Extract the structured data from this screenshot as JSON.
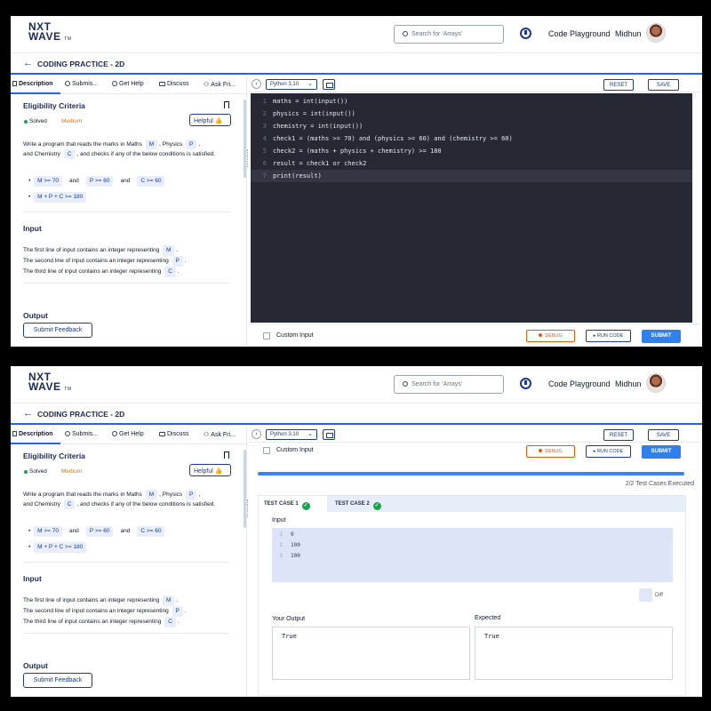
{
  "header": {
    "logo_line1": "NXT",
    "logo_line2": "WAVE",
    "logo_tm": "TM",
    "search_placeholder": "Search for 'Arrays'",
    "playground_label": "Code Playground",
    "username": "Midhun"
  },
  "practice": {
    "title": "CODING PRACTICE - 2D"
  },
  "tabs": {
    "description": "Description",
    "submissions": "Submis...",
    "get_help": "Get Help",
    "discuss": "Discuss",
    "ask_friends": "Ask Fri..."
  },
  "problem": {
    "title": "Eligibility Criteria",
    "status": "Solved",
    "difficulty": "Medium",
    "helpful_label": "Helpful",
    "statement_p1": "Write a program that reads the marks in Maths",
    "var_m": "M",
    "statement_p2": ", Physics",
    "var_p": "P",
    "statement_p3": ",",
    "statement_p4": "and Chemistry",
    "var_c": "C",
    "statement_p5": ", and checks if any of the below conditions is satisfied.",
    "cond1_a": "M >= 70",
    "cond1_and1": "and",
    "cond1_b": "P >= 60",
    "cond1_and2": "and",
    "cond1_c": "C >= 60",
    "cond2": "M + P + C >= 180",
    "input_heading": "Input",
    "input_line1": "The first line of input contains an integer representing",
    "input_line2": "The second line of input contains an integer representing",
    "input_line3": "The third line of input contains an integer representing",
    "dot": ".",
    "output_heading": "Output",
    "feedback_label": "Submit Feedback"
  },
  "editor": {
    "language": "Python 3.10",
    "reset_label": "RESET",
    "save_label": "SAVE",
    "lines": [
      {
        "n": "1",
        "code": "maths = int(input())"
      },
      {
        "n": "2",
        "code": "physics = int(input())"
      },
      {
        "n": "3",
        "code": "chemistry = int(input())"
      },
      {
        "n": "4",
        "code": "check1 = (maths >= 70) and (physics >= 60) and (chemistry >= 60)"
      },
      {
        "n": "5",
        "code": "check2 = (maths + physics + chemistry) >= 180"
      },
      {
        "n": "6",
        "code": "result = check1 or check2"
      },
      {
        "n": "7",
        "code": "print(result)"
      }
    ]
  },
  "actions": {
    "custom_input": "Custom Input",
    "debug": "DEBUG",
    "run_code": "RUN CODE",
    "submit": "SUBMIT"
  },
  "results": {
    "executed": "2/2 Test Cases Executed",
    "tab1": "TEST CASE 1",
    "tab2": "TEST CASE 2",
    "check": "✓",
    "input_label": "Input",
    "input_lines": [
      {
        "n": "1",
        "v": "0"
      },
      {
        "n": "2",
        "v": "100"
      },
      {
        "n": "3",
        "v": "100"
      }
    ],
    "diff_label": "Diff",
    "your_output_label": "Your Output",
    "expected_label": "Expected",
    "your_output": "True",
    "expected": "True"
  },
  "colors": {
    "accent": "#2563eb",
    "brand": "#1e2a55",
    "editor_bg": "#262833",
    "debug": "#ea580c",
    "solved": "#16a34a",
    "medium": "#d97706"
  },
  "icons": [
    "search-icon",
    "timer-icon",
    "avatar",
    "back-arrow-icon",
    "document-icon",
    "clock-icon",
    "help-icon",
    "chat-icon",
    "users-icon",
    "bookmark-icon",
    "thumbs-up-icon",
    "chevron-left-icon",
    "chevron-down-icon",
    "format-icon",
    "bug-icon",
    "play-icon",
    "check-icon"
  ]
}
